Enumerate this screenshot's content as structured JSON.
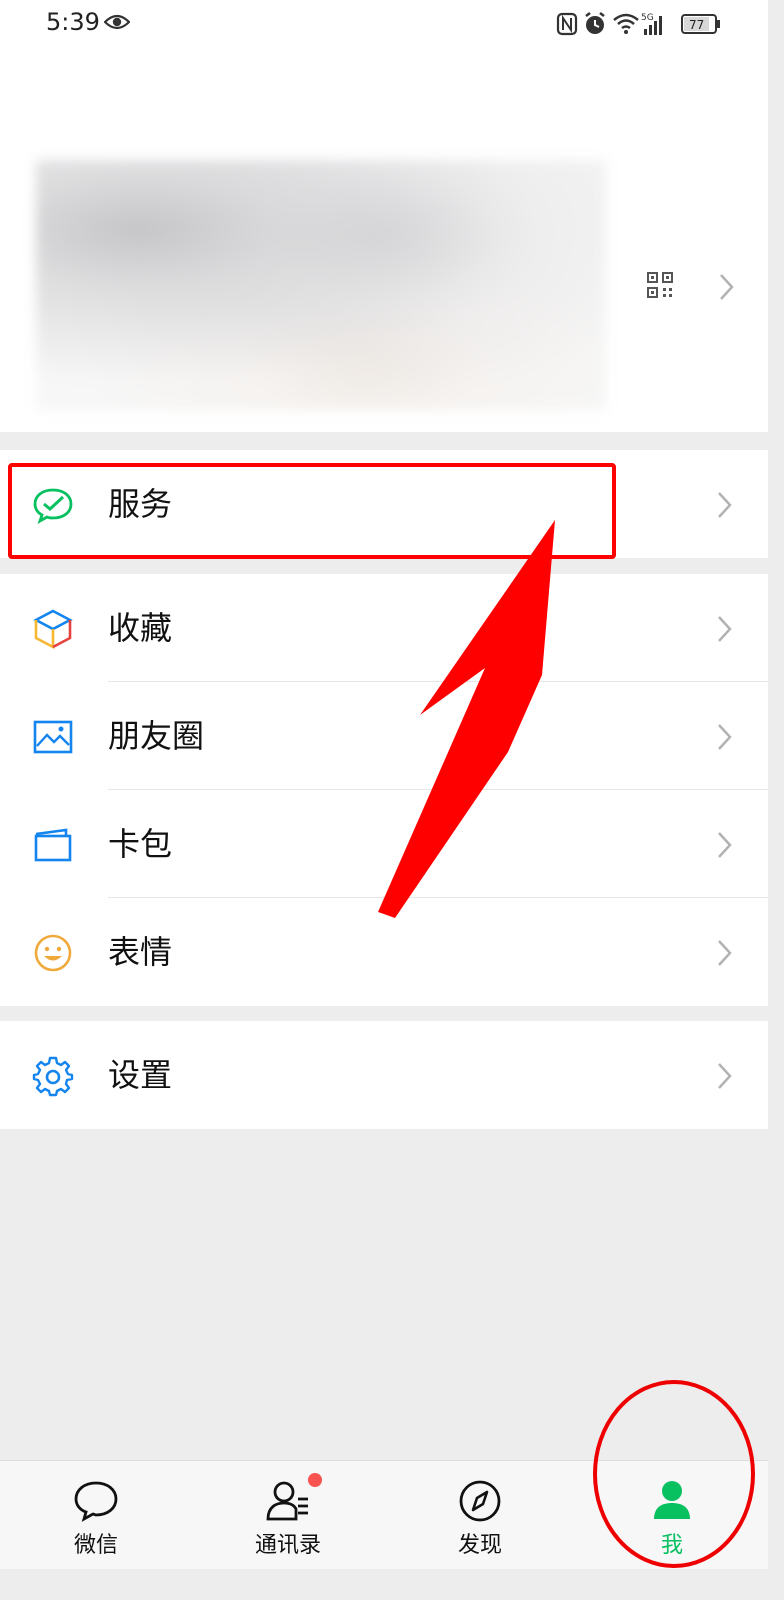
{
  "status_bar": {
    "time": "5:39",
    "network": "5G",
    "battery": "77",
    "icons": [
      "eye-icon",
      "nfc-icon",
      "alarm-icon",
      "wifi-icon",
      "signal-icon",
      "battery-icon"
    ]
  },
  "profile": {
    "icons": [
      "qr-code-icon",
      "chevron-right-icon"
    ]
  },
  "menu": {
    "services": {
      "label": "服务",
      "icon": "wechat-pay-icon",
      "color": "#07c160"
    },
    "favorites": {
      "label": "收藏",
      "icon": "cube-icon"
    },
    "moments": {
      "label": "朋友圈",
      "icon": "photo-icon",
      "color": "#1485ee"
    },
    "cards": {
      "label": "卡包",
      "icon": "wallet-icon",
      "color": "#1485ee"
    },
    "stickers": {
      "label": "表情",
      "icon": "smiley-icon",
      "color": "#f0a93b"
    },
    "settings": {
      "label": "设置",
      "icon": "gear-icon",
      "color": "#1485ee"
    }
  },
  "tabs": [
    {
      "label": "微信",
      "icon": "chat-bubble-icon"
    },
    {
      "label": "通讯录",
      "icon": "contacts-icon"
    },
    {
      "label": "发现",
      "icon": "compass-icon",
      "badge": "red-dot"
    },
    {
      "label": "我",
      "icon": "person-icon",
      "active": true,
      "color": "#07c160"
    }
  ],
  "annotations": {
    "box_color": "#ff0000",
    "arrow_color": "#ff0000",
    "circle_color": "#ee0000"
  }
}
